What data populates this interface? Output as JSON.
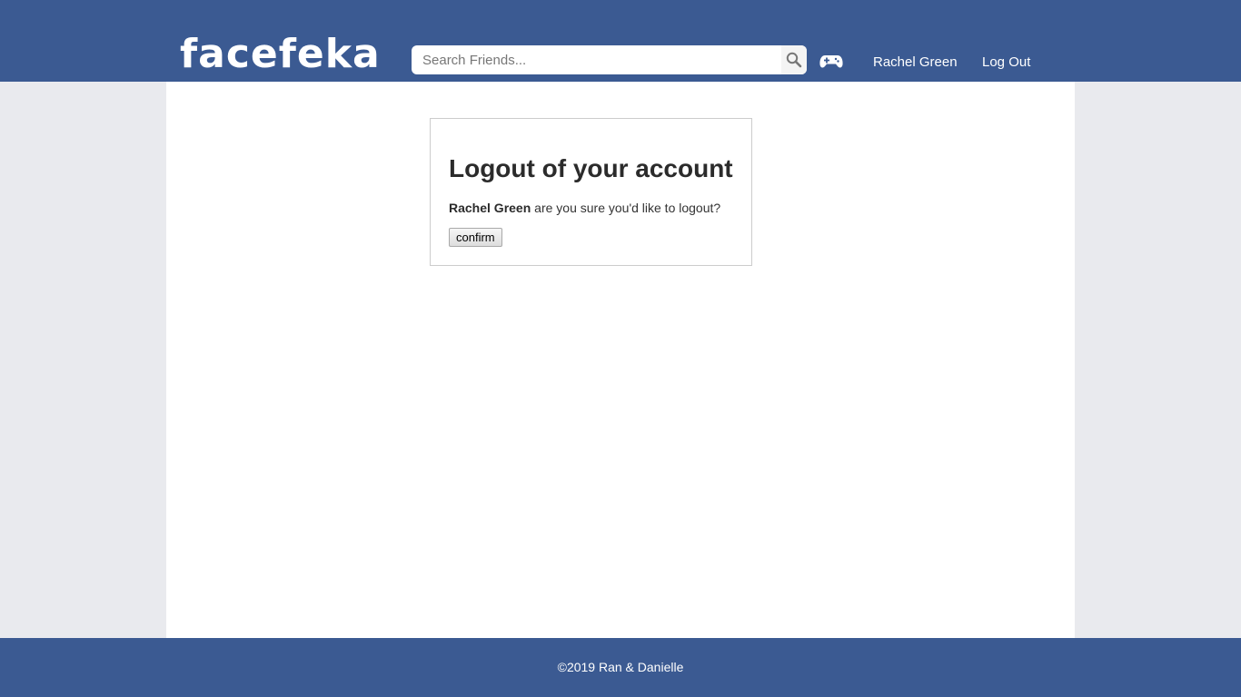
{
  "header": {
    "logo_text": "facefeka",
    "search": {
      "placeholder": "Search Friends...",
      "value": "",
      "icon": "search-icon"
    },
    "games_icon": "gamepad-icon",
    "nav": {
      "user_label": "Rachel Green",
      "logout_label": "Log Out"
    }
  },
  "logout_card": {
    "title": "Logout of your account",
    "user_name": "Rachel Green",
    "message": " are you sure you'd like to logout?",
    "confirm_label": "confirm"
  },
  "footer": {
    "text": "©2019 Ran & Danielle"
  },
  "colors": {
    "brand": "#3b5a92",
    "page_background": "#e9eaee",
    "content_background": "#ffffff"
  }
}
